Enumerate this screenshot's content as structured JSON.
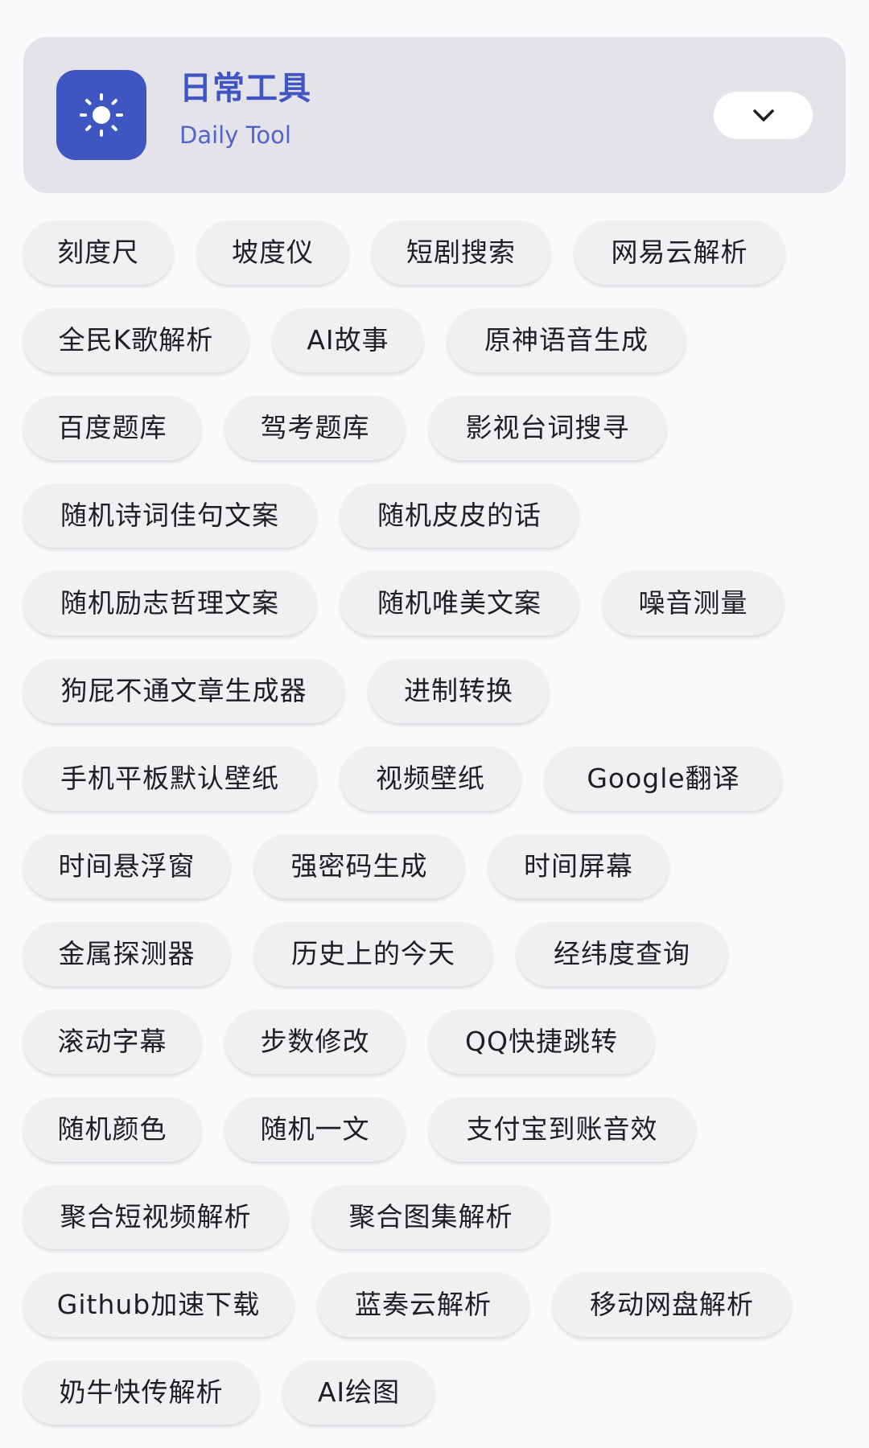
{
  "header": {
    "title": "日常工具",
    "subtitle": "Daily Tool",
    "icon": "sun-icon",
    "expand_icon": "chevron-down-icon",
    "accent_color": "#3f55c2"
  },
  "chips": [
    [
      "刻度尺",
      "坡度仪",
      "短剧搜索",
      "网易云解析"
    ],
    [
      "全民K歌解析",
      "AI故事",
      "原神语音生成"
    ],
    [
      "百度题库",
      "驾考题库",
      "影视台词搜寻"
    ],
    [
      "随机诗词佳句文案",
      "随机皮皮的话"
    ],
    [
      "随机励志哲理文案",
      "随机唯美文案",
      "噪音测量"
    ],
    [
      "狗屁不通文章生成器",
      "进制转换"
    ],
    [
      "手机平板默认壁纸",
      "视频壁纸",
      "Google翻译"
    ],
    [
      "时间悬浮窗",
      "强密码生成",
      "时间屏幕"
    ],
    [
      "金属探测器",
      "历史上的今天",
      "经纬度查询"
    ],
    [
      "滚动字幕",
      "步数修改",
      "QQ快捷跳转"
    ],
    [
      "随机颜色",
      "随机一文",
      "支付宝到账音效"
    ],
    [
      "聚合短视频解析",
      "聚合图集解析"
    ],
    [
      "Github加速下载",
      "蓝奏云解析",
      "移动网盘解析"
    ],
    [
      "奶牛快传解析",
      "AI绘图"
    ]
  ]
}
